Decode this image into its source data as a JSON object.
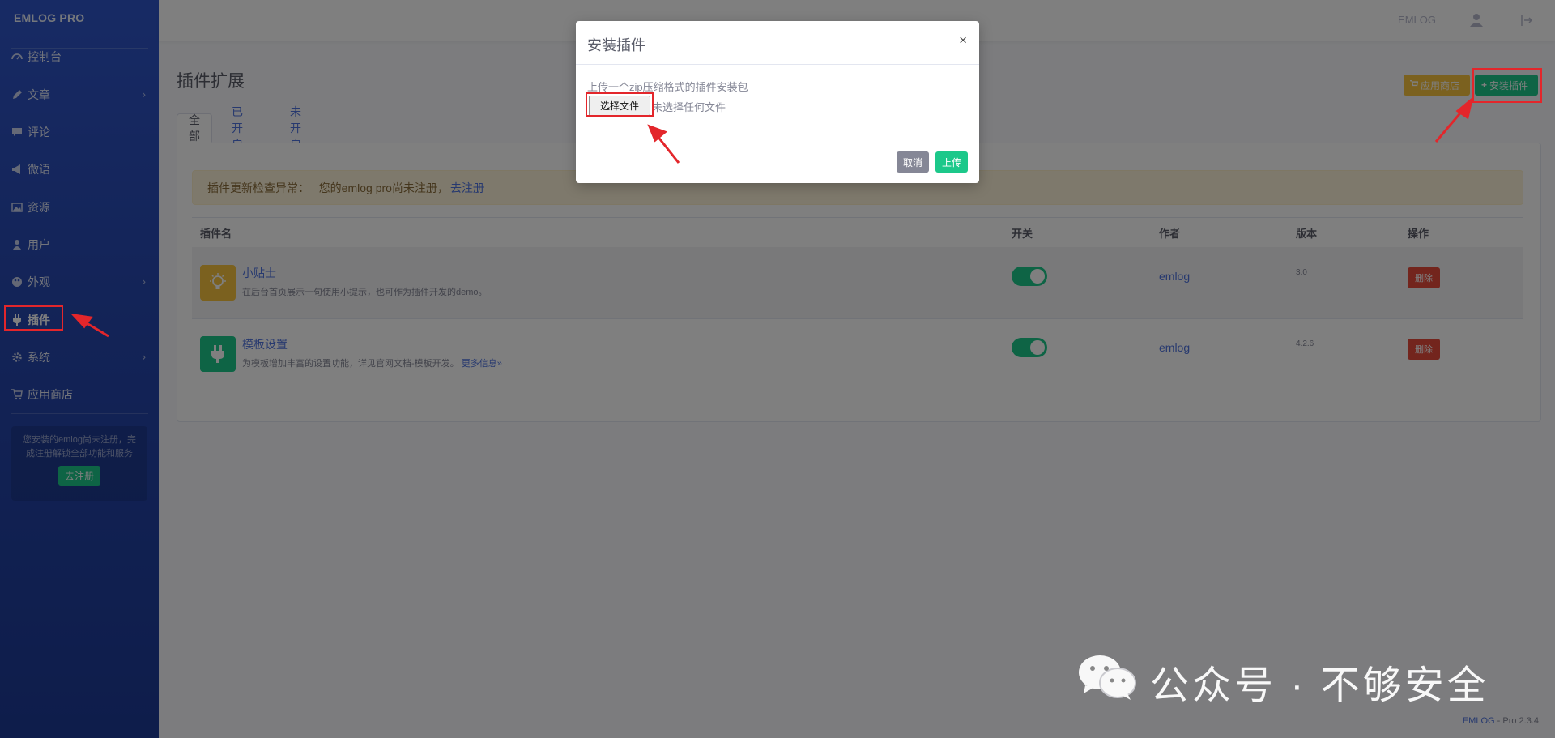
{
  "sidebar": {
    "brand": "EMLOG PRO",
    "items": [
      {
        "label": "控制台",
        "icon": "dashboard-icon",
        "chevron": false
      },
      {
        "label": "文章",
        "icon": "pencil-icon",
        "chevron": true
      },
      {
        "label": "评论",
        "icon": "comment-icon",
        "chevron": false
      },
      {
        "label": "微语",
        "icon": "megaphone-icon",
        "chevron": false
      },
      {
        "label": "资源",
        "icon": "image-icon",
        "chevron": false
      },
      {
        "label": "用户",
        "icon": "user-icon",
        "chevron": false
      },
      {
        "label": "外观",
        "icon": "palette-icon",
        "chevron": true
      },
      {
        "label": "插件",
        "icon": "plug-icon",
        "chevron": false,
        "active": true
      },
      {
        "label": "系统",
        "icon": "gear-icon",
        "chevron": true
      },
      {
        "label": "应用商店",
        "icon": "cart-icon",
        "chevron": false
      }
    ],
    "register_box": {
      "text": "您安装的emlog尚未注册，完成注册解锁全部功能和服务",
      "button": "去注册"
    },
    "chevron_glyph": "›"
  },
  "topbar": {
    "site_name": "EMLOG"
  },
  "main": {
    "title": "插件扩展",
    "store_button": "应用商店",
    "install_button": "安装插件",
    "tabs": [
      "全部",
      "已开启",
      "未开启"
    ],
    "alert": {
      "text": "插件更新检查异常：   您的emlog pro尚未注册，",
      "link": "去注册"
    },
    "table": {
      "headers": [
        "插件名",
        "开关",
        "作者",
        "版本",
        "操作"
      ],
      "rows": [
        {
          "name": "小贴士",
          "desc": "在后台首页展示一句使用小提示，也可作为插件开发的demo。",
          "more": "",
          "enabled": true,
          "author": "emlog",
          "version": "3.0",
          "action": "删除",
          "icon": "lightbulb-icon",
          "icon_bg": "#f6c23e"
        },
        {
          "name": "模板设置",
          "desc": "为模板增加丰富的设置功能，详见官网文档-模板开发。",
          "more": "更多信息»",
          "enabled": true,
          "author": "emlog",
          "version": "4.2.6",
          "action": "删除",
          "icon": "plug-icon",
          "icon_bg": "#1cc88a"
        }
      ]
    }
  },
  "footer": {
    "brand": "EMLOG",
    "version": " - Pro 2.3.4"
  },
  "modal": {
    "title": "安装插件",
    "close": "×",
    "hint": "上传一个zip压缩格式的插件安装包",
    "file_button": "选择文件",
    "file_status": "未选择任何文件",
    "cancel": "取消",
    "upload": "上传"
  },
  "watermark": {
    "text": "公众号 · 不够安全"
  },
  "colors": {
    "primary": "#4e73df",
    "success": "#1cc88a",
    "warning": "#f6c23e",
    "danger": "#e74a3b",
    "annotation": "#e3262b"
  }
}
